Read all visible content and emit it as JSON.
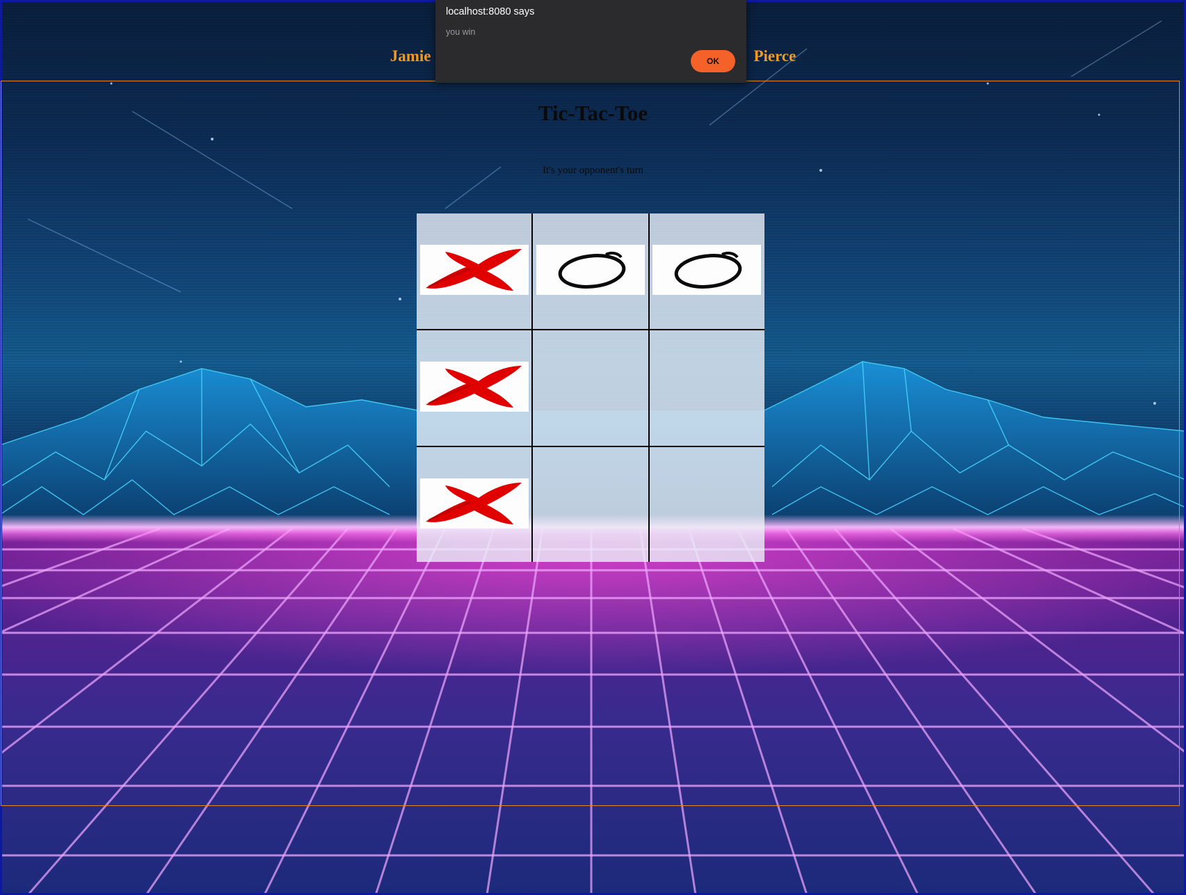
{
  "header": {
    "player_left": "Jamie",
    "player_right": "Pierce"
  },
  "game": {
    "title": "Tic-Tac-Toe",
    "status": "It's your opponent's turn",
    "board": [
      [
        "X",
        "O",
        "O"
      ],
      [
        "X",
        "",
        ""
      ],
      [
        "X",
        "",
        ""
      ]
    ]
  },
  "alert": {
    "title": "localhost:8080 says",
    "message": "you win",
    "ok_label": "OK"
  },
  "colors": {
    "accent_orange": "#f39a1e",
    "x_red": "#e00000",
    "ok_button": "#f4622a"
  },
  "icons": {
    "x_mark": "x-mark-icon",
    "o_mark": "o-mark-icon"
  }
}
